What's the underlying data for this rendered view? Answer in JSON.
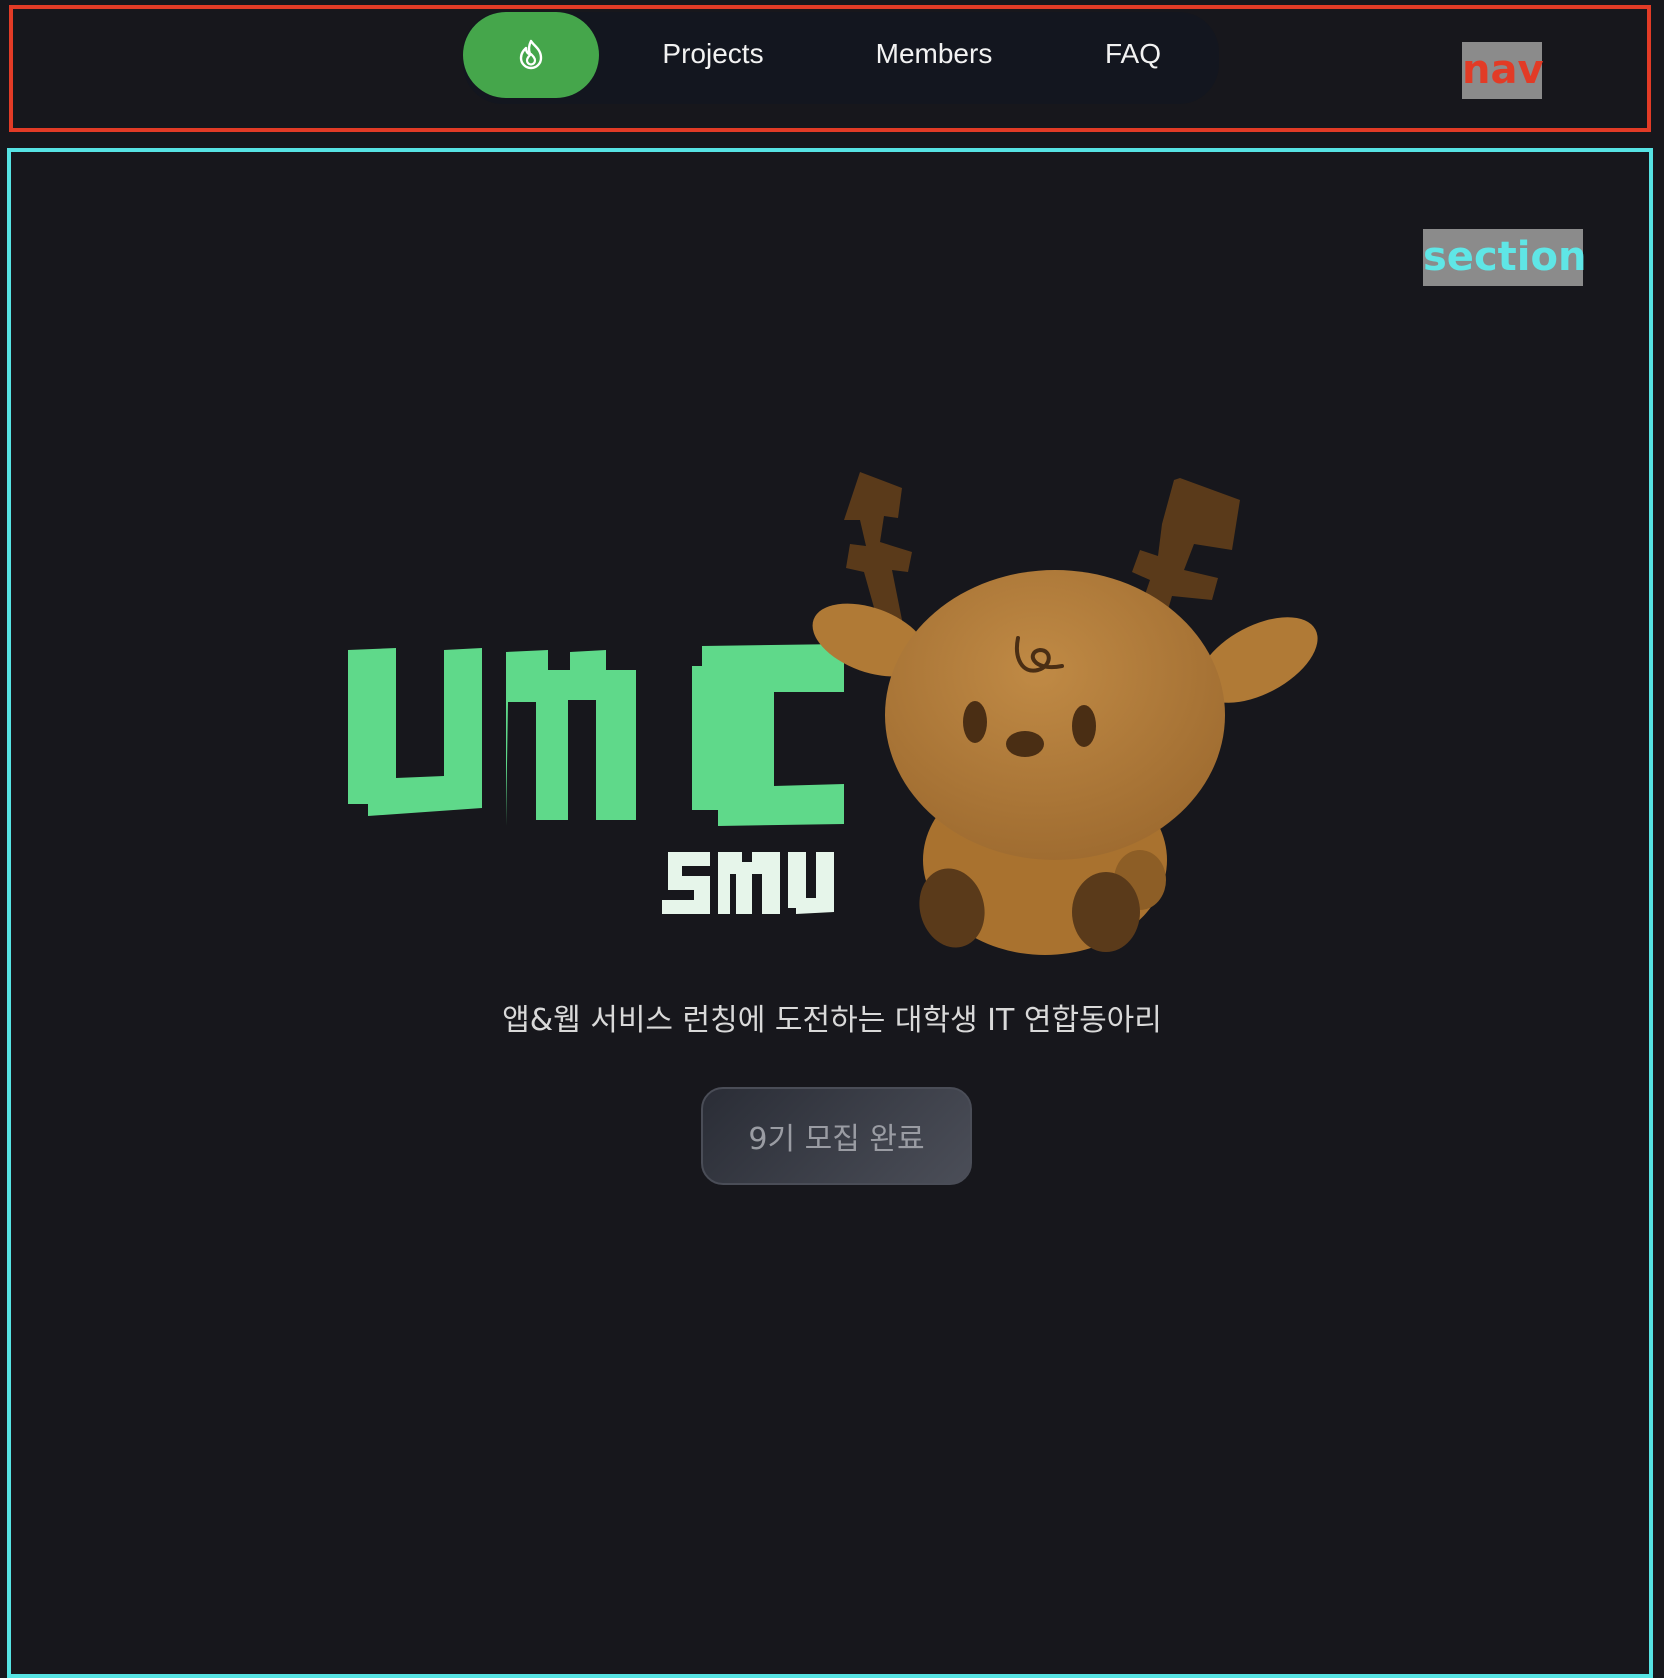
{
  "nav": {
    "home_icon": "flame-icon",
    "links": [
      {
        "label": "Projects"
      },
      {
        "label": "Members"
      },
      {
        "label": "FAQ"
      }
    ],
    "debug_tag": "nav"
  },
  "section": {
    "debug_tag": "section",
    "logo": {
      "primary": "UMC",
      "secondary": "SMU"
    },
    "mascot": "deer-mascot",
    "tagline": "앱&웹 서비스 런칭에 도전하는 대학생 IT 연합동아리",
    "cta_label": "9기 모집 완료"
  },
  "colors": {
    "accent_green": "#45a64b",
    "logo_green": "#5fd98a",
    "background": "#17171c",
    "nav_outline": "#e23b26",
    "section_outline": "#56e3e3"
  }
}
